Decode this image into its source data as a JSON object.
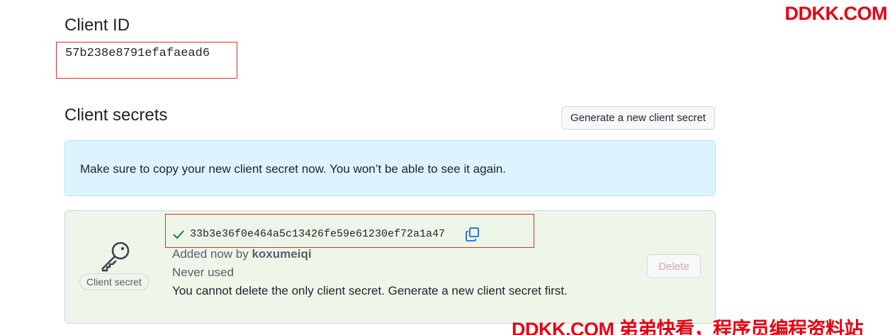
{
  "client_id": {
    "title": "Client ID",
    "value": "57b238e8791efafaead6"
  },
  "client_secrets": {
    "title": "Client secrets",
    "generate_button": "Generate a new client secret",
    "flash_message": "Make sure to copy your new client secret now. You won’t be able to see it again.",
    "secret": {
      "label": "Client secret",
      "value": "33b3e36f0e464a5c13426fe59e61230ef72a1a47",
      "added_prefix": "Added now by ",
      "added_by": "koxumeiqi",
      "usage": "Never used",
      "warning": "You cannot delete the only client secret. Generate a new client secret first.",
      "delete_button": "Delete"
    }
  },
  "icons": {
    "key": "key-icon",
    "check": "check-icon",
    "copy": "copy-icon"
  },
  "colors": {
    "flash_bg": "#ddf4ff",
    "card_bg": "#eef6ea",
    "highlight_box": "#d7302c",
    "check": "#1a7f37",
    "copy": "#0969da",
    "watermark": "#e60012"
  },
  "watermark": {
    "top": "DDKK.COM",
    "bottom": "DDKK.COM 弟弟快看，程序员编程资料站"
  }
}
